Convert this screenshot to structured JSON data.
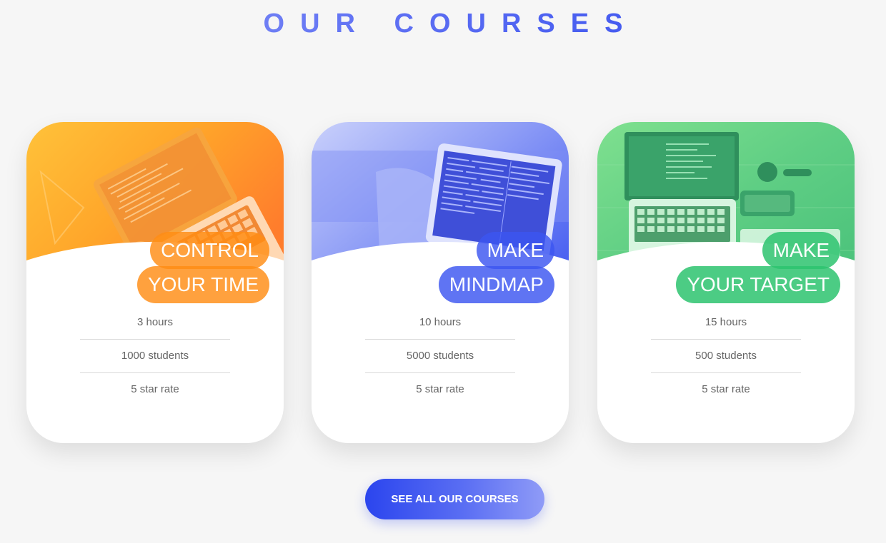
{
  "section": {
    "title": "OUR COURSES"
  },
  "colors": {
    "card1_accent": "#ff8c14",
    "card2_accent": "#3c55f0",
    "card3_accent": "#2dc36e",
    "heading_gradient_start": "#8f9cf8",
    "heading_gradient_end": "#2b45ec"
  },
  "courses": [
    {
      "title_line_1": "CONTROL",
      "title_line_2": "YOUR TIME",
      "image": "laptop-code-photo",
      "stats": [
        "3 hours",
        "1000 students",
        "5 star rate"
      ]
    },
    {
      "title_line_1": "MAKE",
      "title_line_2": "MINDMAP",
      "image": "laptop-on-sofa-photo",
      "stats": [
        "10 hours",
        "5000 students",
        "5 star rate"
      ]
    },
    {
      "title_line_1": "MAKE",
      "title_line_2": "YOUR TARGET",
      "image": "desk-laptop-phone-photo",
      "stats": [
        "15 hours",
        "500 students",
        "5 star rate"
      ]
    }
  ],
  "cta": {
    "label": "SEE ALL OUR COURSES"
  }
}
